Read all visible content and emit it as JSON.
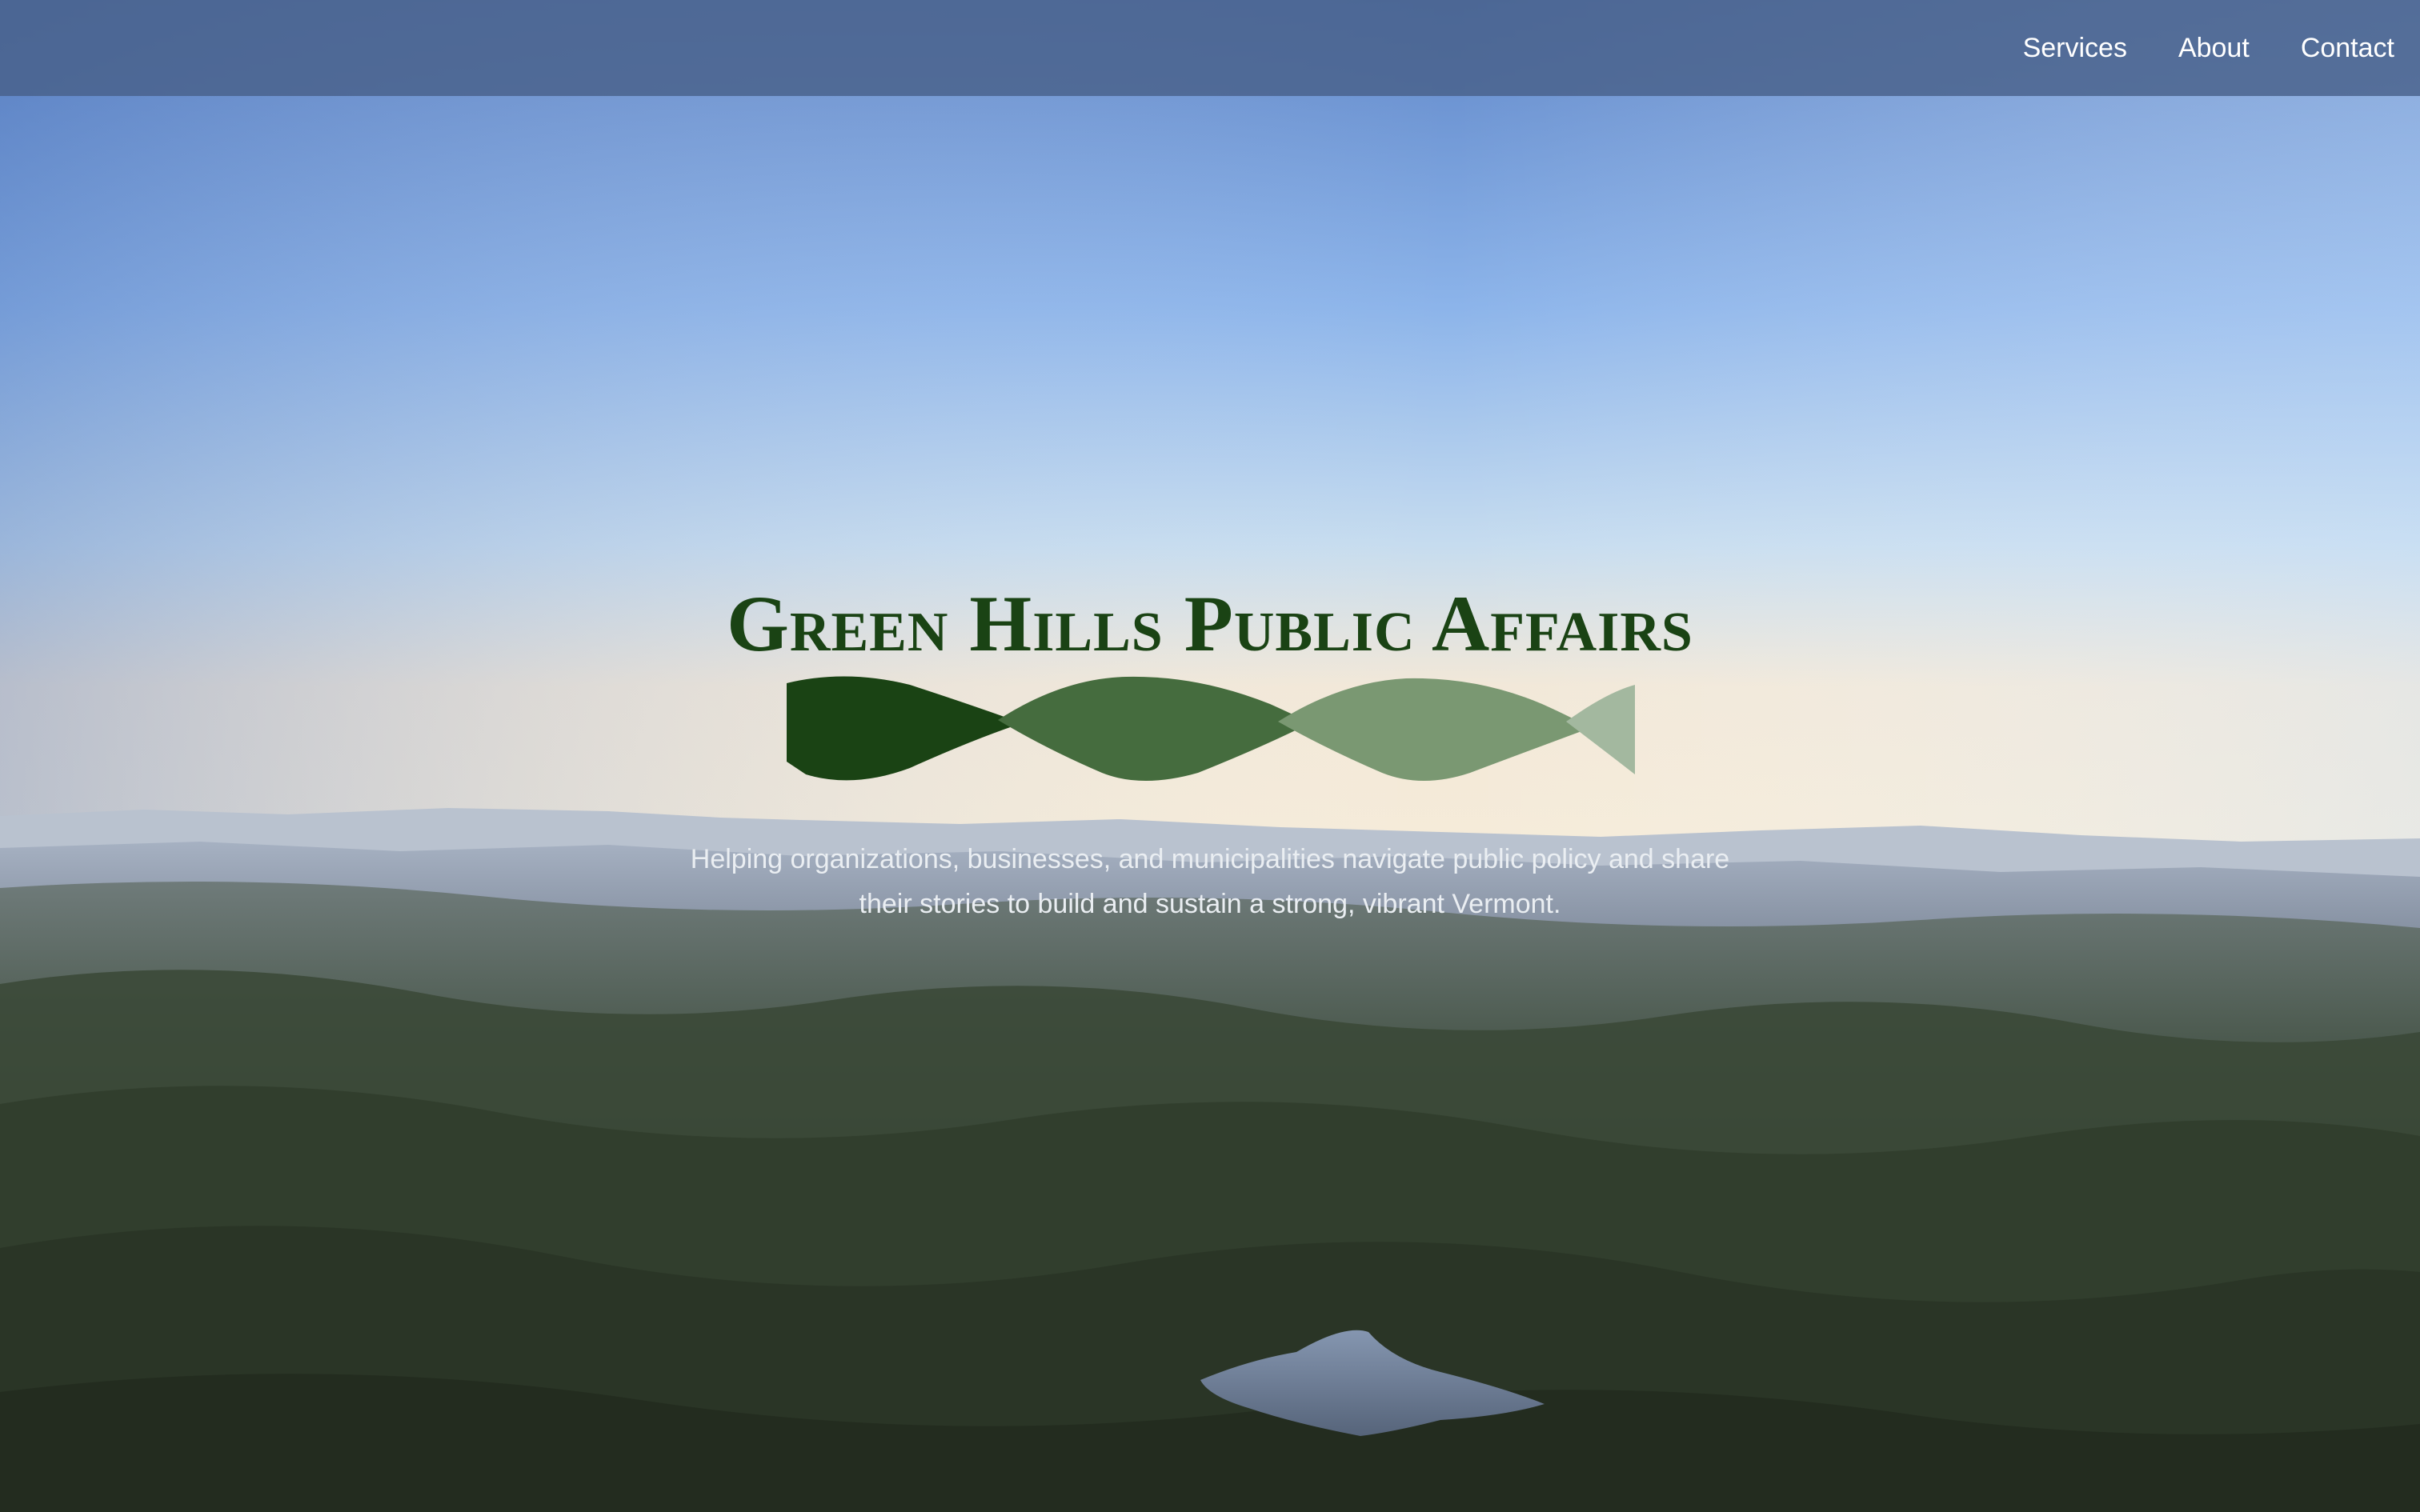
{
  "nav": {
    "items": [
      {
        "label": "Services"
      },
      {
        "label": "About"
      },
      {
        "label": "Contact"
      }
    ]
  },
  "hero": {
    "title": "Green Hills Public Affairs",
    "tagline": "Helping organizations, businesses, and municipalities navigate public policy and share their stories to build and sustain a strong, vibrant Vermont.",
    "background": "aerial landscape photo of forested green hills, distant mountains, blue sky and a small lake"
  },
  "colors": {
    "brand_dark_green": "#1a4314",
    "brand_mid_green": "#456c3e",
    "brand_light_green": "#7a9872",
    "brand_pale_green": "#a3b89f",
    "nav_bar": "#48608a",
    "tagline_text": "#eaeef2"
  }
}
